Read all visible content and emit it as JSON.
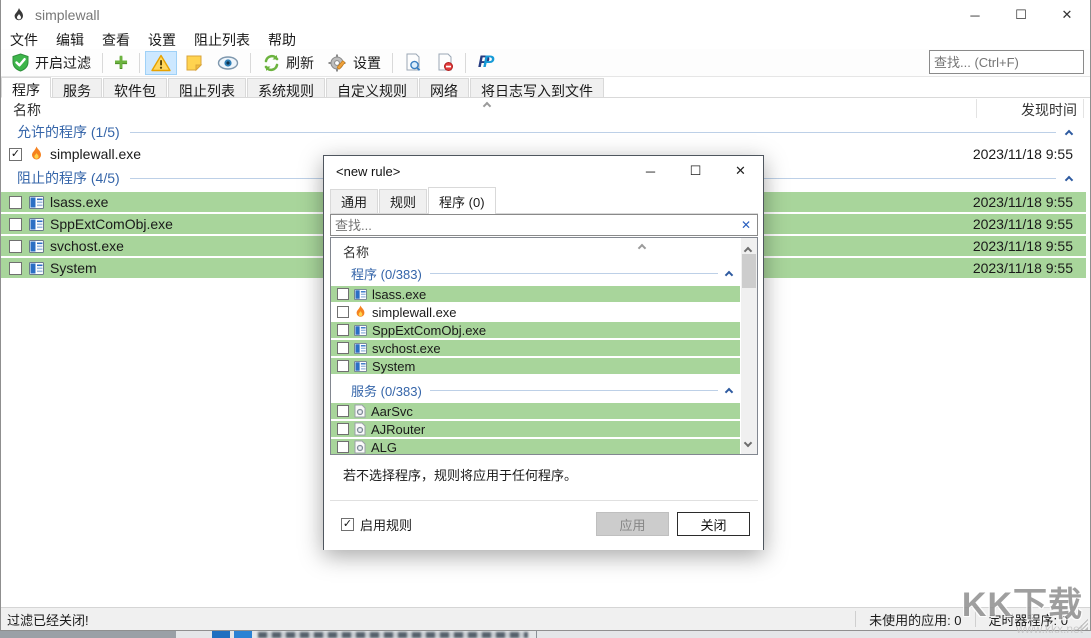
{
  "icons": {
    "minimize": "─",
    "maximize": "☐",
    "close": "✕",
    "check": "✓",
    "clear": "✕",
    "plus": "+",
    "paypal": "P"
  },
  "colors": {
    "row_highlight_green": "#a8d59b",
    "group_text_blue": "#3565a9",
    "toolbar_toggle_bg": "#cde8ff",
    "shield_green": "#3db54a",
    "warning_yellow": "#ffb900"
  },
  "titlebar": {
    "title": "simplewall"
  },
  "menubar": {
    "items": [
      {
        "label": "文件"
      },
      {
        "label": "编辑"
      },
      {
        "label": "查看"
      },
      {
        "label": "设置"
      },
      {
        "label": "阻止列表"
      },
      {
        "label": "帮助"
      }
    ]
  },
  "toolbar": {
    "enable_filter": "开启过滤",
    "refresh": "刷新",
    "settings": "设置"
  },
  "search": {
    "placeholder": "查找... (Ctrl+F)"
  },
  "tabs": [
    {
      "label": "程序",
      "active": true
    },
    {
      "label": "服务"
    },
    {
      "label": "软件包"
    },
    {
      "label": "阻止列表"
    },
    {
      "label": "系统规则"
    },
    {
      "label": "自定义规则"
    },
    {
      "label": "网络"
    },
    {
      "label": "将日志写入到文件"
    }
  ],
  "columns": {
    "name": "名称",
    "time": "发现时间"
  },
  "main_list": {
    "group_allowed": "允许的程序 (1/5)",
    "group_blocked": "阻止的程序 (4/5)",
    "rows": [
      {
        "name": "simplewall.exe",
        "time": "2023/11/18 9:55",
        "checked": true,
        "highlighted": false
      },
      {
        "name": "lsass.exe",
        "time": "2023/11/18 9:55",
        "checked": false,
        "highlighted": true
      },
      {
        "name": "SppExtComObj.exe",
        "time": "2023/11/18 9:55",
        "checked": false,
        "highlighted": true
      },
      {
        "name": "svchost.exe",
        "time": "2023/11/18 9:55",
        "checked": false,
        "highlighted": true
      },
      {
        "name": "System",
        "time": "2023/11/18 9:55",
        "checked": false,
        "highlighted": true
      }
    ]
  },
  "statusbar": {
    "message": "过滤已经关闭!",
    "unused_apps": "未使用的应用: 0",
    "timers": "定时器程序: 0"
  },
  "dialog": {
    "title": "<new rule>",
    "tabs": [
      {
        "label": "通用"
      },
      {
        "label": "规则"
      },
      {
        "label": "程序 (0)",
        "active": true
      }
    ],
    "search_placeholder": "查找...",
    "column_name": "名称",
    "group_programs": "程序 (0/383)",
    "group_services": "服务 (0/383)",
    "programs": [
      {
        "name": "lsass.exe",
        "highlighted": true
      },
      {
        "name": "simplewall.exe",
        "highlighted": false
      },
      {
        "name": "SppExtComObj.exe",
        "highlighted": true
      },
      {
        "name": "svchost.exe",
        "highlighted": true
      },
      {
        "name": "System",
        "highlighted": true
      }
    ],
    "services": [
      {
        "name": "AarSvc"
      },
      {
        "name": "AJRouter"
      },
      {
        "name": "ALG"
      }
    ],
    "note": "若不选择程序，规则将应用于任何程序。",
    "enable_rule": "启用规则",
    "apply": "应用",
    "close": "关闭"
  },
  "watermark": {
    "line1": "KK下载",
    "line2": "www.kkx.net"
  }
}
